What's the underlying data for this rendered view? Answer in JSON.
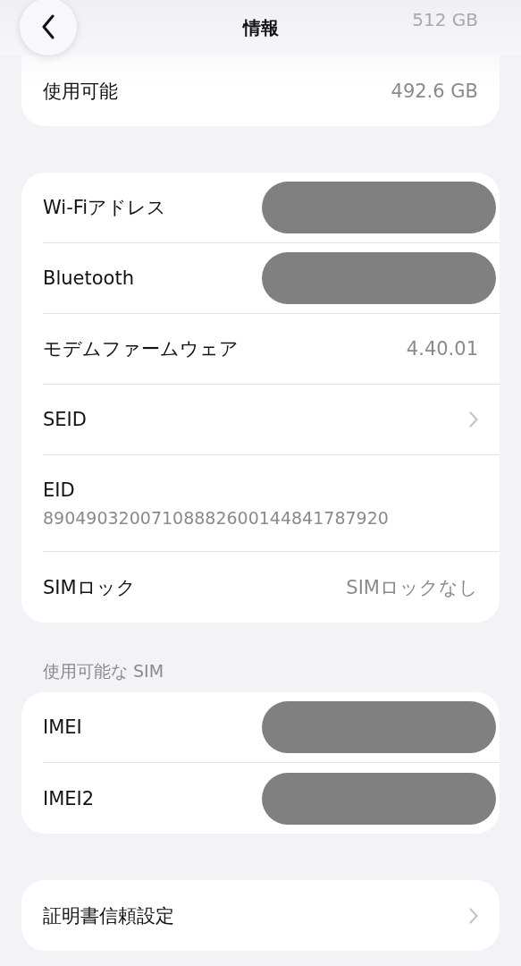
{
  "header": {
    "title": "情報",
    "faded_value": "512 GB"
  },
  "sections": [
    {
      "rows": [
        {
          "kind": "value",
          "label": "使用可能",
          "value": "492.6 GB"
        }
      ]
    },
    {
      "rows": [
        {
          "kind": "redacted",
          "label": "Wi-Fiアドレス"
        },
        {
          "kind": "redacted",
          "label": "Bluetooth"
        },
        {
          "kind": "value",
          "label": "モデムファームウェア",
          "value": "4.40.01"
        },
        {
          "kind": "chevron",
          "label": "SEID"
        },
        {
          "kind": "stacked",
          "label": "EID",
          "value": "89049032007108882600144841787920"
        },
        {
          "kind": "value",
          "label": "SIMロック",
          "value": "SIMロックなし"
        }
      ]
    },
    {
      "title": "使用可能な SIM",
      "rows": [
        {
          "kind": "redacted",
          "label": "IMEI"
        },
        {
          "kind": "redacted",
          "label": "IMEI2"
        }
      ]
    },
    {
      "rows": [
        {
          "kind": "chevron",
          "label": "証明書信頼設定"
        }
      ]
    }
  ]
}
